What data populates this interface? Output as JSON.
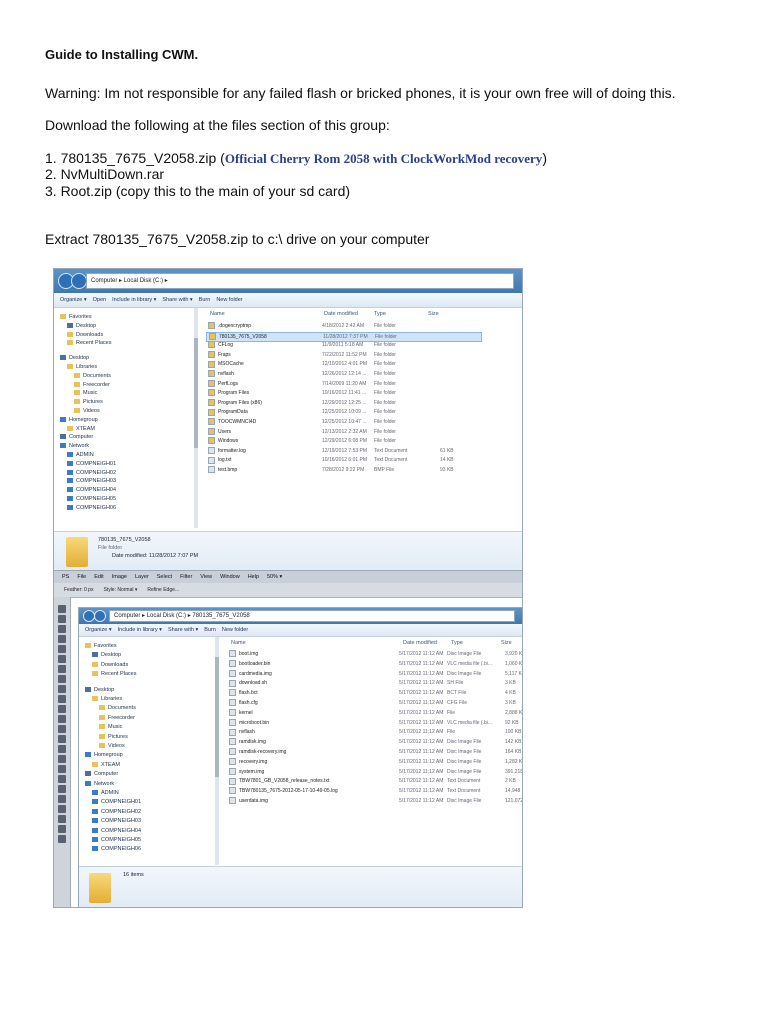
{
  "doc": {
    "title": "Guide to Installing CWM.",
    "warning": "Warning: Im not responsible for any failed flash or bricked phones, it is your own free will of doing this.",
    "download_intro": "Download the following at the files section of this group:",
    "item1_prefix": "1. 780135_7675_V2058.zip  (",
    "item1_note": "Official Cherry Rom 2058 with ClockWorkMod recovery",
    "item1_suffix": ")",
    "item2": "2. NvMultiDown.rar",
    "item3": "3. Root.zip  (copy this to the main of your sd card)",
    "extract": "Extract 780135_7675_V2058.zip to c:\\ drive on your computer"
  },
  "shot1": {
    "address": "Computer  ▸  Local Disk (C:)  ▸",
    "toolbar": [
      "Organize ▾",
      "Open",
      "Include in library ▾",
      "Share with ▾",
      "Burn",
      "New folder"
    ],
    "columns": [
      "Name",
      "Date modified",
      "Type",
      "Size"
    ],
    "sidebar": [
      "Favorites",
      "Desktop",
      "Downloads",
      "Recent Places",
      "Desktop",
      "Libraries",
      "Documents",
      "Freecorder",
      "Music",
      "Pictures",
      "Videos",
      "Homegroup",
      "XTEAM",
      "Computer",
      "Network",
      "ADMIN",
      "COMPNEIGH01",
      "COMPNEIGH02",
      "COMPNEIGH03",
      "COMPNEIGH04",
      "COMPNEIGH05",
      "COMPNEIGH06"
    ],
    "files": [
      {
        "name": ".dogencryptmp",
        "date": "4/18/2012 2:42 AM",
        "type": "File folder",
        "size": ""
      },
      {
        "name": "780135_7675_V2058",
        "date": "11/28/2012 7:37 PM",
        "type": "File folder",
        "size": ""
      },
      {
        "name": "CFLog",
        "date": "11/9/2011 5:18 AM",
        "type": "File folder",
        "size": ""
      },
      {
        "name": "Fraps",
        "date": "7/22/2012 11:52 PM",
        "type": "File folder",
        "size": ""
      },
      {
        "name": "MSOCache",
        "date": "12/10/2012 4:01 PM",
        "type": "File folder",
        "size": ""
      },
      {
        "name": "nvflash",
        "date": "12/26/2012 12:14 ...",
        "type": "File folder",
        "size": ""
      },
      {
        "name": "PerfLogs",
        "date": "7/14/2009 11:20 AM",
        "type": "File folder",
        "size": ""
      },
      {
        "name": "Program Files",
        "date": "10/16/2012 11:41 ...",
        "type": "File folder",
        "size": ""
      },
      {
        "name": "Program Files (x86)",
        "date": "12/29/2012 12:25 ...",
        "type": "File folder",
        "size": ""
      },
      {
        "name": "ProgramData",
        "date": "12/25/2012 10:09 ...",
        "type": "File folder",
        "size": ""
      },
      {
        "name": "TOOCWMNCI4D",
        "date": "12/25/2012 10:47 ...",
        "type": "File folder",
        "size": ""
      },
      {
        "name": "Users",
        "date": "12/13/2012 2:32 AM",
        "type": "File folder",
        "size": ""
      },
      {
        "name": "Windows",
        "date": "12/29/2012 6:08 PM",
        "type": "File folder",
        "size": ""
      },
      {
        "name": "formatter.log",
        "date": "12/19/2012 7:53 PM",
        "type": "Text Document",
        "size": "61 KB"
      },
      {
        "name": "log.txt",
        "date": "10/16/2012 6:01 PM",
        "type": "Text Document",
        "size": "14 KB"
      },
      {
        "name": "test.bmp",
        "date": "7/28/2012 9:22 PM",
        "type": "BMP File",
        "size": "93 KB"
      }
    ],
    "details_name": "780135_7675_V2058",
    "details_type": "File folder",
    "details_date": "Date modified: 11/28/2012 7:07 PM"
  },
  "shot2": {
    "ps_menu": [
      "PS",
      "File",
      "Edit",
      "Image",
      "Layer",
      "Select",
      "Filter",
      "View",
      "Window",
      "Help",
      "50% ▾"
    ],
    "ps_opts": [
      "Feather: 0 px",
      "Style: Normal ▾",
      "Refine Edge..."
    ],
    "address": "Computer  ▸  Local Disk (C:)  ▸  780135_7675_V2058",
    "toolbar": [
      "Organize ▾",
      "Include in library ▾",
      "Share with ▾",
      "Burn",
      "New folder"
    ],
    "columns": [
      "Name",
      "Date modified",
      "Type",
      "Size"
    ],
    "sidebar": [
      "Favorites",
      "Desktop",
      "Downloads",
      "Recent Places",
      "Desktop",
      "Libraries",
      "Documents",
      "Freecorder",
      "Music",
      "Pictures",
      "Videos",
      "Homegroup",
      "XTEAM",
      "Computer",
      "Network",
      "ADMIN",
      "COMPNEIGH01",
      "COMPNEIGH02",
      "COMPNEIGH03",
      "COMPNEIGH04",
      "COMPNEIGH05",
      "COMPNEIGH06"
    ],
    "files": [
      {
        "name": "boot.img",
        "date": "5/17/2012 11:12 AM",
        "type": "Disc Image File",
        "size": "3,920 KB"
      },
      {
        "name": "bootloader.bin",
        "date": "5/17/2012 11:12 AM",
        "type": "VLC media file (.bi...",
        "size": "1,060 KB"
      },
      {
        "name": "cardmedia.img",
        "date": "5/17/2012 11:12 AM",
        "type": "Disc Image File",
        "size": "5,117 KB"
      },
      {
        "name": "download.sh",
        "date": "5/17/2012 11:12 AM",
        "type": "SH File",
        "size": "3 KB"
      },
      {
        "name": "flash.bct",
        "date": "5/17/2012 11:12 AM",
        "type": "BCT File",
        "size": "4 KB"
      },
      {
        "name": "flash.cfg",
        "date": "5/17/2012 11:12 AM",
        "type": "CFG File",
        "size": "3 KB"
      },
      {
        "name": "kernel",
        "date": "5/17/2012 11:12 AM",
        "type": "File",
        "size": "2,888 KB"
      },
      {
        "name": "microboot.bin",
        "date": "5/17/2012 11:12 AM",
        "type": "VLC media file (.bi...",
        "size": "92 KB"
      },
      {
        "name": "nvflash",
        "date": "5/17/2012 11:12 AM",
        "type": "File",
        "size": "100 KB"
      },
      {
        "name": "ramdisk.img",
        "date": "5/17/2012 11:12 AM",
        "type": "Disc Image File",
        "size": "142 KB"
      },
      {
        "name": "ramdisk-recovery.img",
        "date": "5/17/2012 11:12 AM",
        "type": "Disc Image File",
        "size": "164 KB"
      },
      {
        "name": "recovery.img",
        "date": "5/17/2012 11:12 AM",
        "type": "Disc Image File",
        "size": "1,282 KB"
      },
      {
        "name": "system.img",
        "date": "5/17/2012 11:12 AM",
        "type": "Disc Image File",
        "size": "391,218 KB"
      },
      {
        "name": "TBW7801_GB_V2058_release_notes.txt",
        "date": "5/17/2012 11:12 AM",
        "type": "Text Document",
        "size": "2 KB"
      },
      {
        "name": "TBW780135_7675-2012-05-17-10-49-05.log",
        "date": "5/17/2012 11:12 AM",
        "type": "Text Document",
        "size": "14,948 KB"
      },
      {
        "name": "userdata.img",
        "date": "5/17/2012 11:12 AM",
        "type": "Disc Image File",
        "size": "121,072 KB"
      }
    ],
    "details_count": "16 items"
  },
  "colors": {
    "accent": "#3f78ae",
    "selection": "#cfe3f9",
    "folder": "#e9c25a",
    "link_text": "#2a3f8f"
  }
}
